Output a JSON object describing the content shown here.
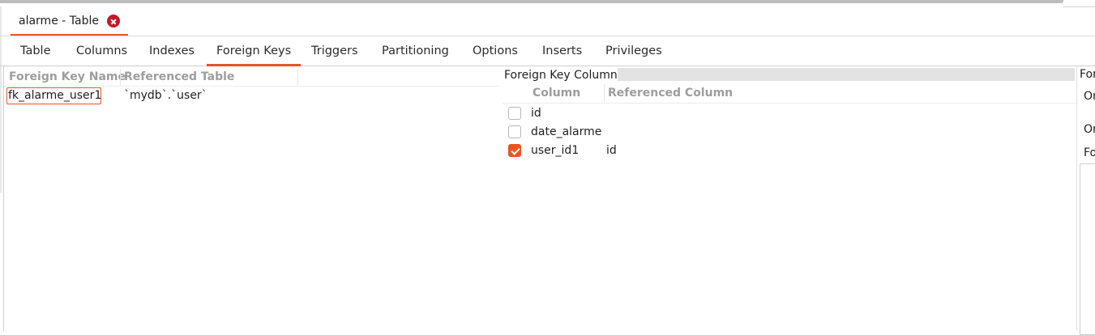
{
  "document_tab": {
    "label": "alarme - Table"
  },
  "tabs": [
    "Table",
    "Columns",
    "Indexes",
    "Foreign Keys",
    "Triggers",
    "Partitioning",
    "Options",
    "Inserts",
    "Privileges"
  ],
  "active_tab": "Foreign Keys",
  "fk_table": {
    "headers": {
      "name": "Foreign Key Name",
      "referenced": "Referenced Table"
    },
    "rows": [
      {
        "name": "fk_alarme_user1",
        "referenced": "`mydb`.`user`"
      }
    ]
  },
  "fk_columns": {
    "title": "Foreign Key Columns",
    "headers": {
      "column": "Column",
      "referenced": "Referenced Column"
    },
    "rows": [
      {
        "checked": false,
        "column": "id",
        "referenced": ""
      },
      {
        "checked": false,
        "column": "date_alarme",
        "referenced": ""
      },
      {
        "checked": true,
        "column": "user_id1",
        "referenced": "id"
      }
    ]
  },
  "right_pane": {
    "title_fragment": "For",
    "on_update_fragment": "On",
    "on_delete_fragment": "On",
    "comment_fragment": "Fo"
  },
  "colors": {
    "accent": "#e95420",
    "close": "#c7162b",
    "header_text": "#9e9e9e"
  }
}
